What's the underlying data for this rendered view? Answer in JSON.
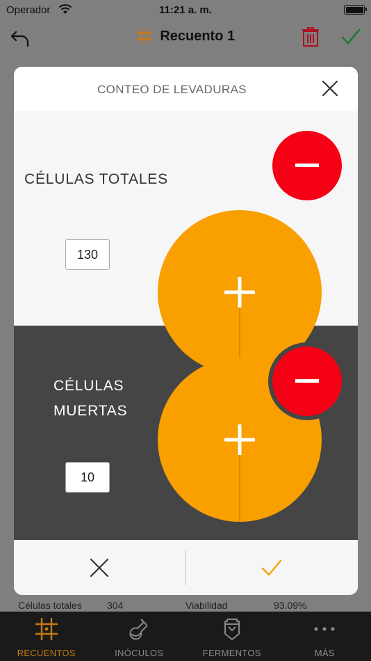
{
  "status_bar": {
    "carrier": "Operador",
    "time": "11:21 a. m."
  },
  "nav": {
    "title": "Recuento 1"
  },
  "modal": {
    "title": "CONTEO DE LEVADURAS",
    "total_label": "CÉLULAS TOTALES",
    "total_count": "130",
    "dead_label_line1": "CÉLULAS",
    "dead_label_line2": "MUERTAS",
    "dead_count": "10"
  },
  "background_summary": {
    "total_label": "Células totales",
    "total_value": "304",
    "viability_label": "Viabilidad",
    "viability_value": "93.09%"
  },
  "tabs": [
    {
      "label": "RECUENTOS",
      "icon": "grid-icon",
      "active": true
    },
    {
      "label": "INÓCULOS",
      "icon": "flask-icon",
      "active": false
    },
    {
      "label": "FERMENTOS",
      "icon": "fermenter-icon",
      "active": false
    },
    {
      "label": "MÁS",
      "icon": "more-icon",
      "active": false
    }
  ],
  "colors": {
    "accent": "#f99f00",
    "danger": "#f50116",
    "tab_active": "#c87a10",
    "confirm_green": "#1f7a2a"
  }
}
